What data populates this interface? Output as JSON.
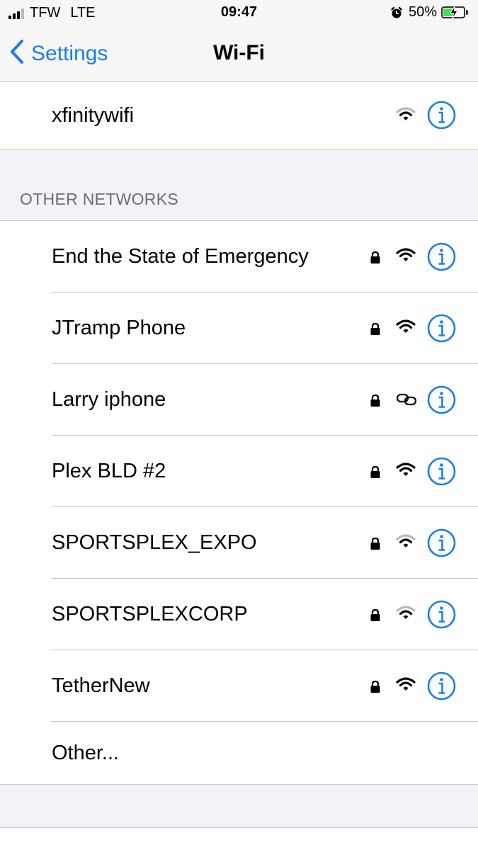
{
  "status_bar": {
    "carrier": "TFW",
    "network_type": "LTE",
    "time": "09:47",
    "battery_percent": "50%",
    "battery_level": 0.5,
    "signal_bars_active": 3,
    "signal_bars_total": 4,
    "alarm_icon": "alarm-clock-icon"
  },
  "nav": {
    "back_label": "Settings",
    "title": "Wi-Fi"
  },
  "connected_network": {
    "name": "xfinitywifi",
    "secured": false,
    "signal_icon": "wifi-icon",
    "signal_strength": 2
  },
  "other_networks": {
    "header": "OTHER NETWORKS",
    "items": [
      {
        "name": "End the State of Emergency",
        "secured": true,
        "signal_icon": "wifi-icon",
        "signal_strength": 3
      },
      {
        "name": "JTramp Phone",
        "secured": true,
        "signal_icon": "wifi-icon",
        "signal_strength": 3
      },
      {
        "name": "Larry iphone",
        "secured": true,
        "signal_icon": "personal-hotspot-icon",
        "signal_strength": null
      },
      {
        "name": "Plex BLD #2",
        "secured": true,
        "signal_icon": "wifi-icon",
        "signal_strength": 3
      },
      {
        "name": "SPORTSPLEX_EXPO",
        "secured": true,
        "signal_icon": "wifi-icon",
        "signal_strength": 2
      },
      {
        "name": "SPORTSPLEXCORP",
        "secured": true,
        "signal_icon": "wifi-icon",
        "signal_strength": 2
      },
      {
        "name": "TetherNew",
        "secured": true,
        "signal_icon": "wifi-icon",
        "signal_strength": 3
      }
    ],
    "other_label": "Other..."
  },
  "colors": {
    "accent": "#1a7ee8",
    "background": "#f2f2f7",
    "separator": "#c8c7cc",
    "battery_fill": "#4cd964",
    "header_text": "#6d6d72"
  }
}
